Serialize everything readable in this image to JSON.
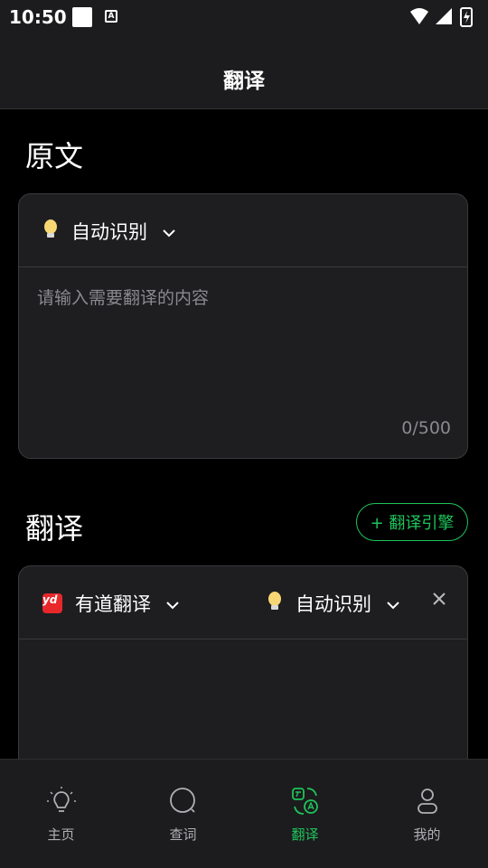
{
  "status_bar": {
    "time": "10:50"
  },
  "header": {
    "title": "翻译"
  },
  "source": {
    "section_title": "原文",
    "language": "自动识别",
    "placeholder": "请输入需要翻译的内容",
    "counter": "0/500"
  },
  "translation": {
    "section_title": "翻译",
    "add_engine_label": "+ 翻译引擎",
    "engine": {
      "logo_text": "yd",
      "name": "有道翻译"
    },
    "target_language": "自动识别"
  },
  "tabbar": {
    "tabs": [
      {
        "label": "主页",
        "icon": "bulb-icon",
        "active": false
      },
      {
        "label": "查词",
        "icon": "search-icon",
        "active": false
      },
      {
        "label": "翻译",
        "icon": "translate-icon",
        "active": true
      },
      {
        "label": "我的",
        "icon": "person-icon",
        "active": false
      }
    ]
  },
  "colors": {
    "accent": "#1fc35b",
    "background": "#000000",
    "surface": "#1e1e21",
    "brand_red": "#e8272b"
  }
}
